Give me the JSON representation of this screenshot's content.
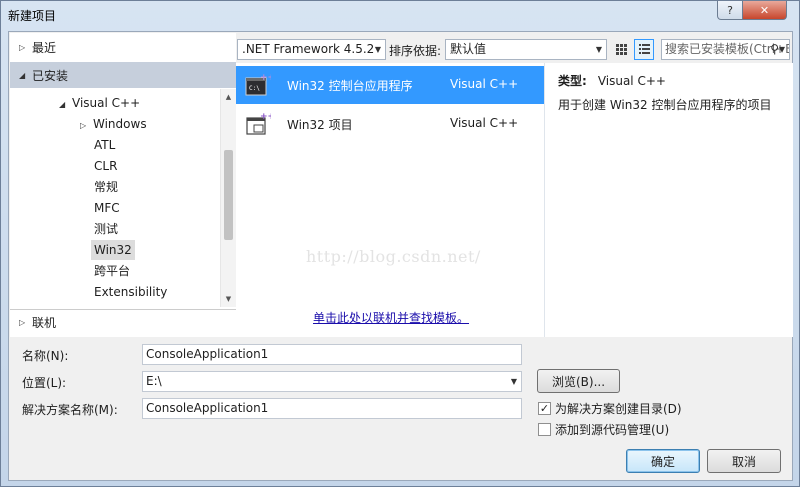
{
  "window": {
    "title": "新建项目",
    "help_label": "?",
    "close_label": "✕"
  },
  "left": {
    "recent": "最近",
    "installed": "已安装",
    "online": "联机",
    "tree": [
      {
        "label": "Visual C++",
        "expanded": true
      },
      {
        "label": "Windows",
        "expanded": false
      },
      {
        "label": "ATL"
      },
      {
        "label": "CLR"
      },
      {
        "label": "常规"
      },
      {
        "label": "MFC"
      },
      {
        "label": "测试"
      },
      {
        "label": "Win32",
        "selected": true
      },
      {
        "label": "跨平台"
      },
      {
        "label": "Extensibility"
      }
    ]
  },
  "toolbar": {
    "framework": ".NET Framework 4.5.2",
    "sort_label": "排序依据:",
    "sort_value": "默认值",
    "search_placeholder": "搜索已安装模板(Ctrl+E)"
  },
  "templates": [
    {
      "name": "Win32 控制台应用程序",
      "language": "Visual C++",
      "selected": true
    },
    {
      "name": "Win32 项目",
      "language": "Visual C++",
      "selected": false
    }
  ],
  "online_link": "单击此处以联机并查找模板。",
  "description": {
    "type_label": "类型:",
    "type_value": "Visual C++",
    "text": "用于创建 Win32 控制台应用程序的项目"
  },
  "watermark": "http://blog.csdn.net/",
  "form": {
    "name_label": "名称(N):",
    "name_value": "ConsoleApplication1",
    "location_label": "位置(L):",
    "location_value": "E:\\",
    "solution_label": "解决方案名称(M):",
    "solution_value": "ConsoleApplication1",
    "browse_label": "浏览(B)...",
    "create_dir_label": "为解决方案创建目录(D)",
    "create_dir_checked": true,
    "source_control_label": "添加到源代码管理(U)",
    "source_control_checked": false,
    "ok_label": "确定",
    "cancel_label": "取消"
  }
}
